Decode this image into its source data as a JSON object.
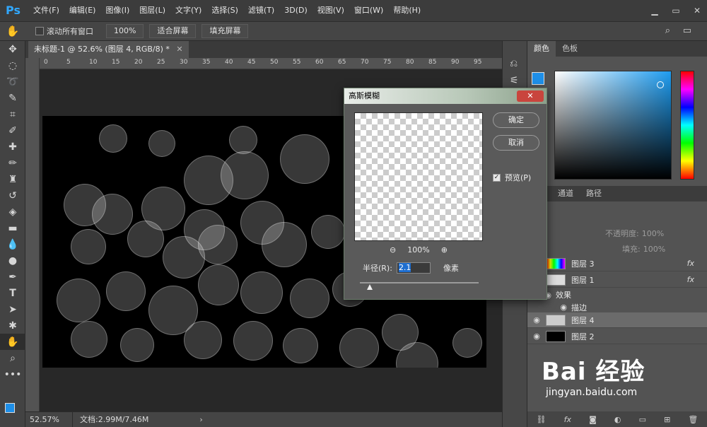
{
  "app": {
    "logo": "Ps"
  },
  "menu": [
    "文件(F)",
    "编辑(E)",
    "图像(I)",
    "图层(L)",
    "文字(Y)",
    "选择(S)",
    "滤镜(T)",
    "3D(D)",
    "视图(V)",
    "窗口(W)",
    "帮助(H)"
  ],
  "options_bar": {
    "scroll_all_label": "滚动所有窗口",
    "zoom_100": "100%",
    "fit_screen": "适合屏幕",
    "fill_screen": "填充屏幕"
  },
  "document": {
    "tab_title": "未标题-1 @ 52.6% (图层 4, RGB/8) *"
  },
  "ruler_ticks": [
    "0",
    "5",
    "10",
    "15",
    "20",
    "25",
    "30",
    "35",
    "40",
    "45",
    "50",
    "55",
    "60",
    "65",
    "70",
    "75",
    "80",
    "85",
    "90",
    "95"
  ],
  "status": {
    "zoom": "52.57%",
    "doc_info": "文档:2.99M/7.46M"
  },
  "color_panel": {
    "tabs": [
      "颜色",
      "色板"
    ],
    "fg": "#1e8fe8",
    "bg": "#ffffff"
  },
  "layers_panel": {
    "tabs": [
      "通道",
      "路径"
    ],
    "opacity_label": "不透明度:",
    "opacity_value": "100%",
    "fill_label": "填充:",
    "fill_value": "100%",
    "layers": [
      {
        "name": "图层 3",
        "fx": "fx"
      },
      {
        "name": "图层 1",
        "fx": "fx"
      },
      {
        "name": "效果"
      },
      {
        "name": "描边"
      },
      {
        "name": "图层 4",
        "selected": true
      },
      {
        "name": "图层 2"
      }
    ]
  },
  "dialog": {
    "title": "高斯模糊",
    "ok": "确定",
    "cancel": "取消",
    "preview_label": "预览(P)",
    "zoom_level": "100%",
    "radius_label": "半径(R):",
    "radius_value": "2.1",
    "unit": "像素",
    "close": "✕"
  },
  "watermark": {
    "logo": "Bai 经验",
    "url": "jingyan.baidu.com"
  }
}
